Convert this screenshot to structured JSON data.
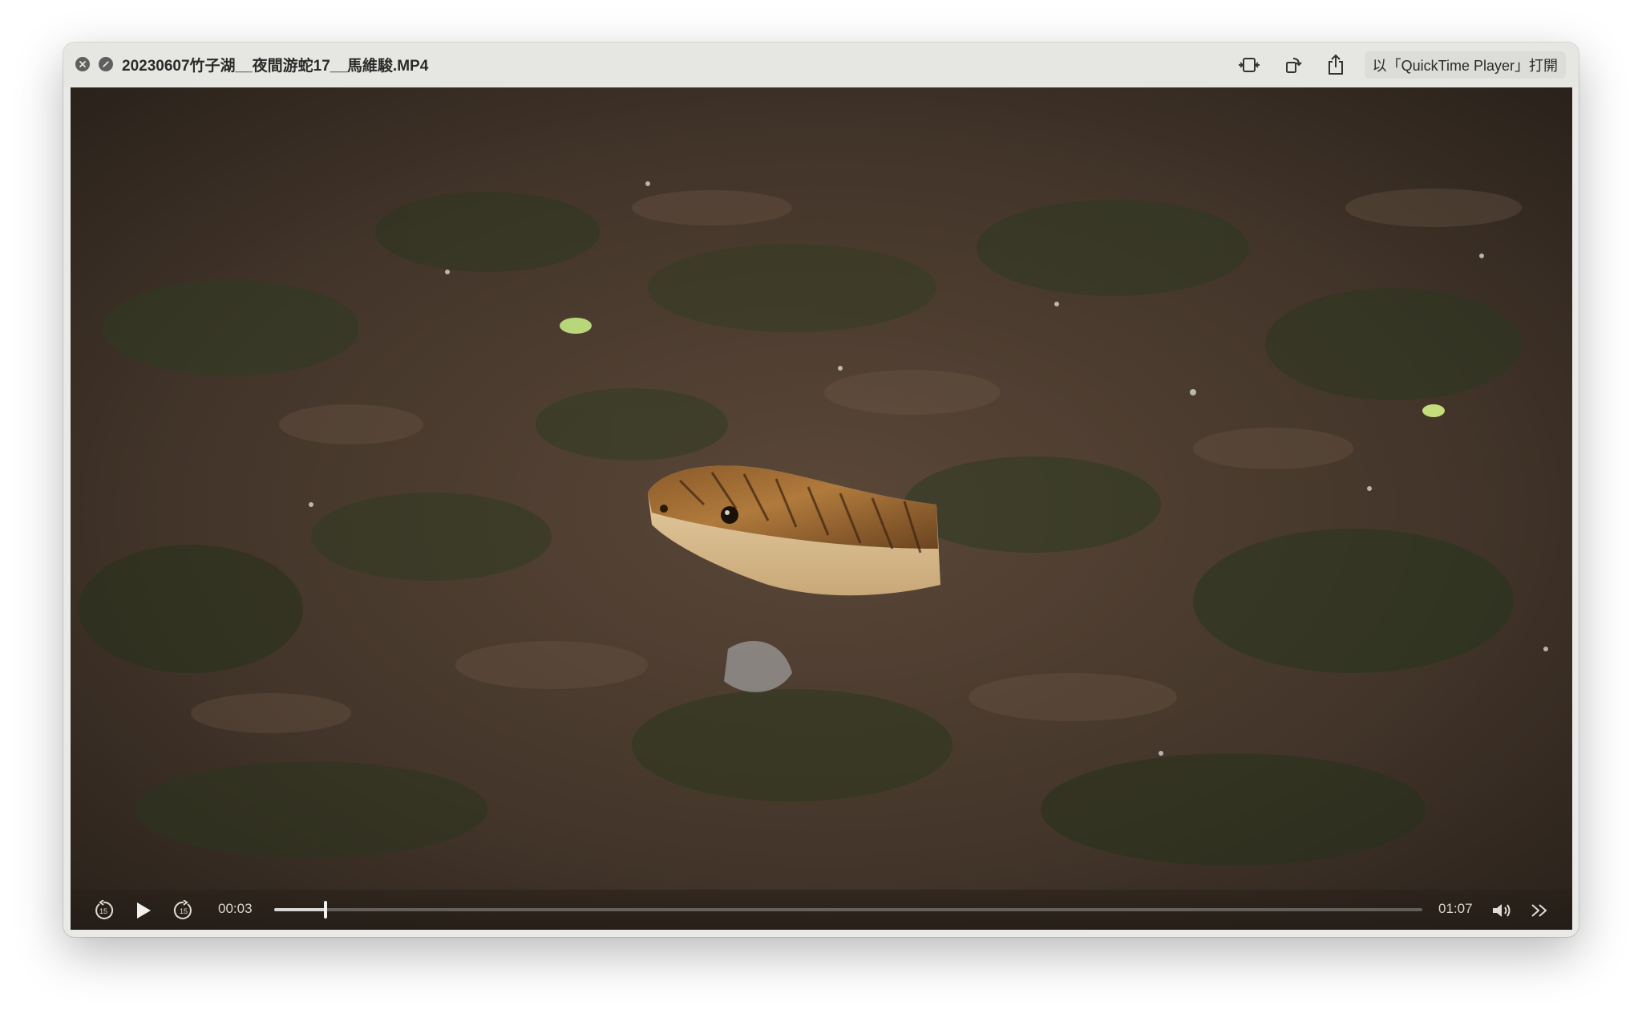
{
  "window": {
    "title": "20230607竹子湖__夜間游蛇17__馬維駿.MP4",
    "open_button_label": "以「QuickTime Player」打開"
  },
  "toolbar": {
    "icons": [
      "trim-icon",
      "rotate-icon",
      "share-icon"
    ]
  },
  "player": {
    "current_time": "00:03",
    "duration": "01:07",
    "progress": 0.045,
    "skip_back_seconds": "15",
    "skip_forward_seconds": "15"
  }
}
